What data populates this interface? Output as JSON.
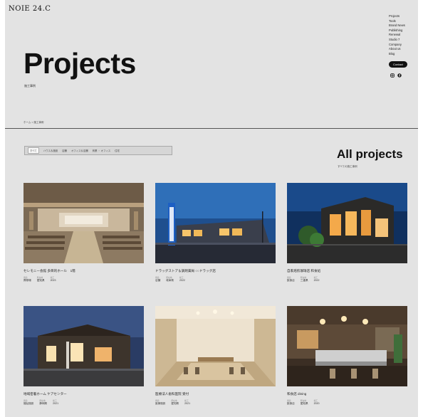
{
  "header": {
    "logo": "NOIE 24.C",
    "title": "Projects",
    "subtitle": "施工事例",
    "breadcrumb": "ホーム > 施工事例"
  },
  "nav": {
    "items": [
      "Projects",
      "Tools",
      "Brand News",
      "Publishing",
      "Renewal",
      "Studio 7",
      "Company",
      "About us",
      "Blog"
    ],
    "contact_label": "Contact"
  },
  "filters": {
    "items": [
      "すべて",
      "ハウス＆施設",
      "店舗",
      "オフィス＆店舗",
      "商業 ・ オフィス",
      "住宅"
    ]
  },
  "section": {
    "title": "All projects",
    "subtitle": "すべての施工事例"
  },
  "meta_labels": {
    "category": "用途",
    "place": "所在地",
    "year": "竣工"
  },
  "projects": [
    {
      "title": "セレモニー会館 多目的ホール　1階",
      "category": "葬祭場",
      "place": "愛知県",
      "year": "2023"
    },
    {
      "title": "ドラッグストア＆調剤薬局 ○○ドラッグ店",
      "category": "店舗",
      "place": "岐阜県",
      "year": "2022"
    },
    {
      "title": "自家焙煎珈琲店 和食処",
      "category": "飲食店",
      "place": "三重県",
      "year": "2022"
    },
    {
      "title": "地域密着ホーム ケアセンター",
      "category": "福祉施設",
      "place": "静岡県",
      "year": "2021"
    },
    {
      "title": "医療法人歯科医院 受付",
      "category": "医療施設",
      "place": "愛知県",
      "year": "2021"
    },
    {
      "title": "和食店 dining",
      "category": "飲食店",
      "place": "愛知県",
      "year": "2020"
    }
  ]
}
